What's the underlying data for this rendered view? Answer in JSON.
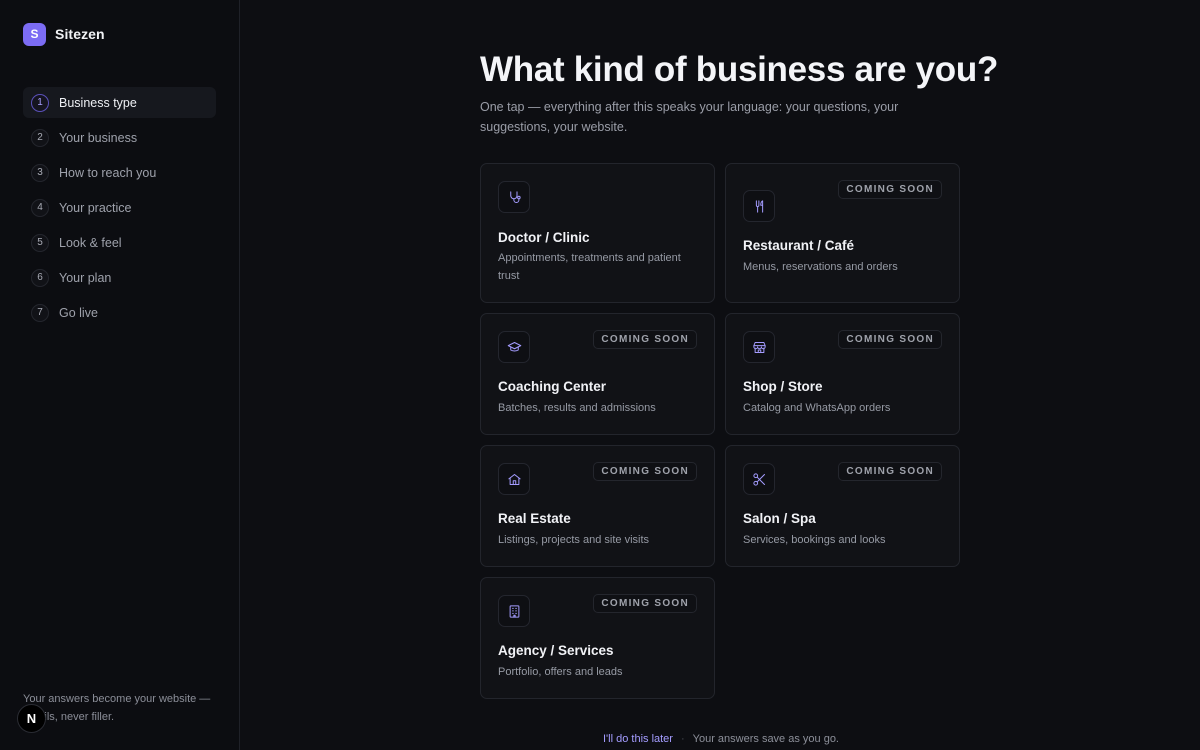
{
  "brand": {
    "logo_letter": "S",
    "name": "Sitezen"
  },
  "steps": [
    {
      "num": "1",
      "label": "Business type",
      "active": true
    },
    {
      "num": "2",
      "label": "Your business"
    },
    {
      "num": "3",
      "label": "How to reach you"
    },
    {
      "num": "4",
      "label": "Your practice"
    },
    {
      "num": "5",
      "label": "Look & feel"
    },
    {
      "num": "6",
      "label": "Your plan"
    },
    {
      "num": "7",
      "label": "Go live"
    }
  ],
  "sidebar_foot": "Your answers become your website — details, never filler.",
  "next_badge": "N",
  "header": {
    "title": "What kind of business are you?",
    "subtitle": "One tap — everything after this speaks your language: your questions, your suggestions, your website."
  },
  "cards": [
    {
      "title": "Doctor / Clinic",
      "desc": "Appointments, treatments and patient trust",
      "icon": "stethoscope-icon",
      "badge": ""
    },
    {
      "title": "Restaurant / Café",
      "desc": "Menus, reservations and orders",
      "icon": "utensils-icon",
      "badge": "COMING SOON"
    },
    {
      "title": "Coaching Center",
      "desc": "Batches, results and admissions",
      "icon": "graduation-cap-icon",
      "badge": "COMING SOON"
    },
    {
      "title": "Shop / Store",
      "desc": "Catalog and WhatsApp orders",
      "icon": "storefront-icon",
      "badge": "COMING SOON"
    },
    {
      "title": "Real Estate",
      "desc": "Listings, projects and site visits",
      "icon": "house-icon",
      "badge": "COMING SOON"
    },
    {
      "title": "Salon / Spa",
      "desc": "Services, bookings and looks",
      "icon": "scissors-icon",
      "badge": "COMING SOON"
    },
    {
      "title": "Agency / Services",
      "desc": "Portfolio, offers and leads",
      "icon": "building-icon",
      "badge": "COMING SOON"
    }
  ],
  "footer": {
    "later_label": "I'll do this later",
    "separator": "·",
    "save_note": "Your answers save as you go."
  },
  "colors": {
    "accent": "#7c6cf4",
    "accent_light": "#a49cff",
    "background": "#0d0e12",
    "card": "#111216"
  }
}
